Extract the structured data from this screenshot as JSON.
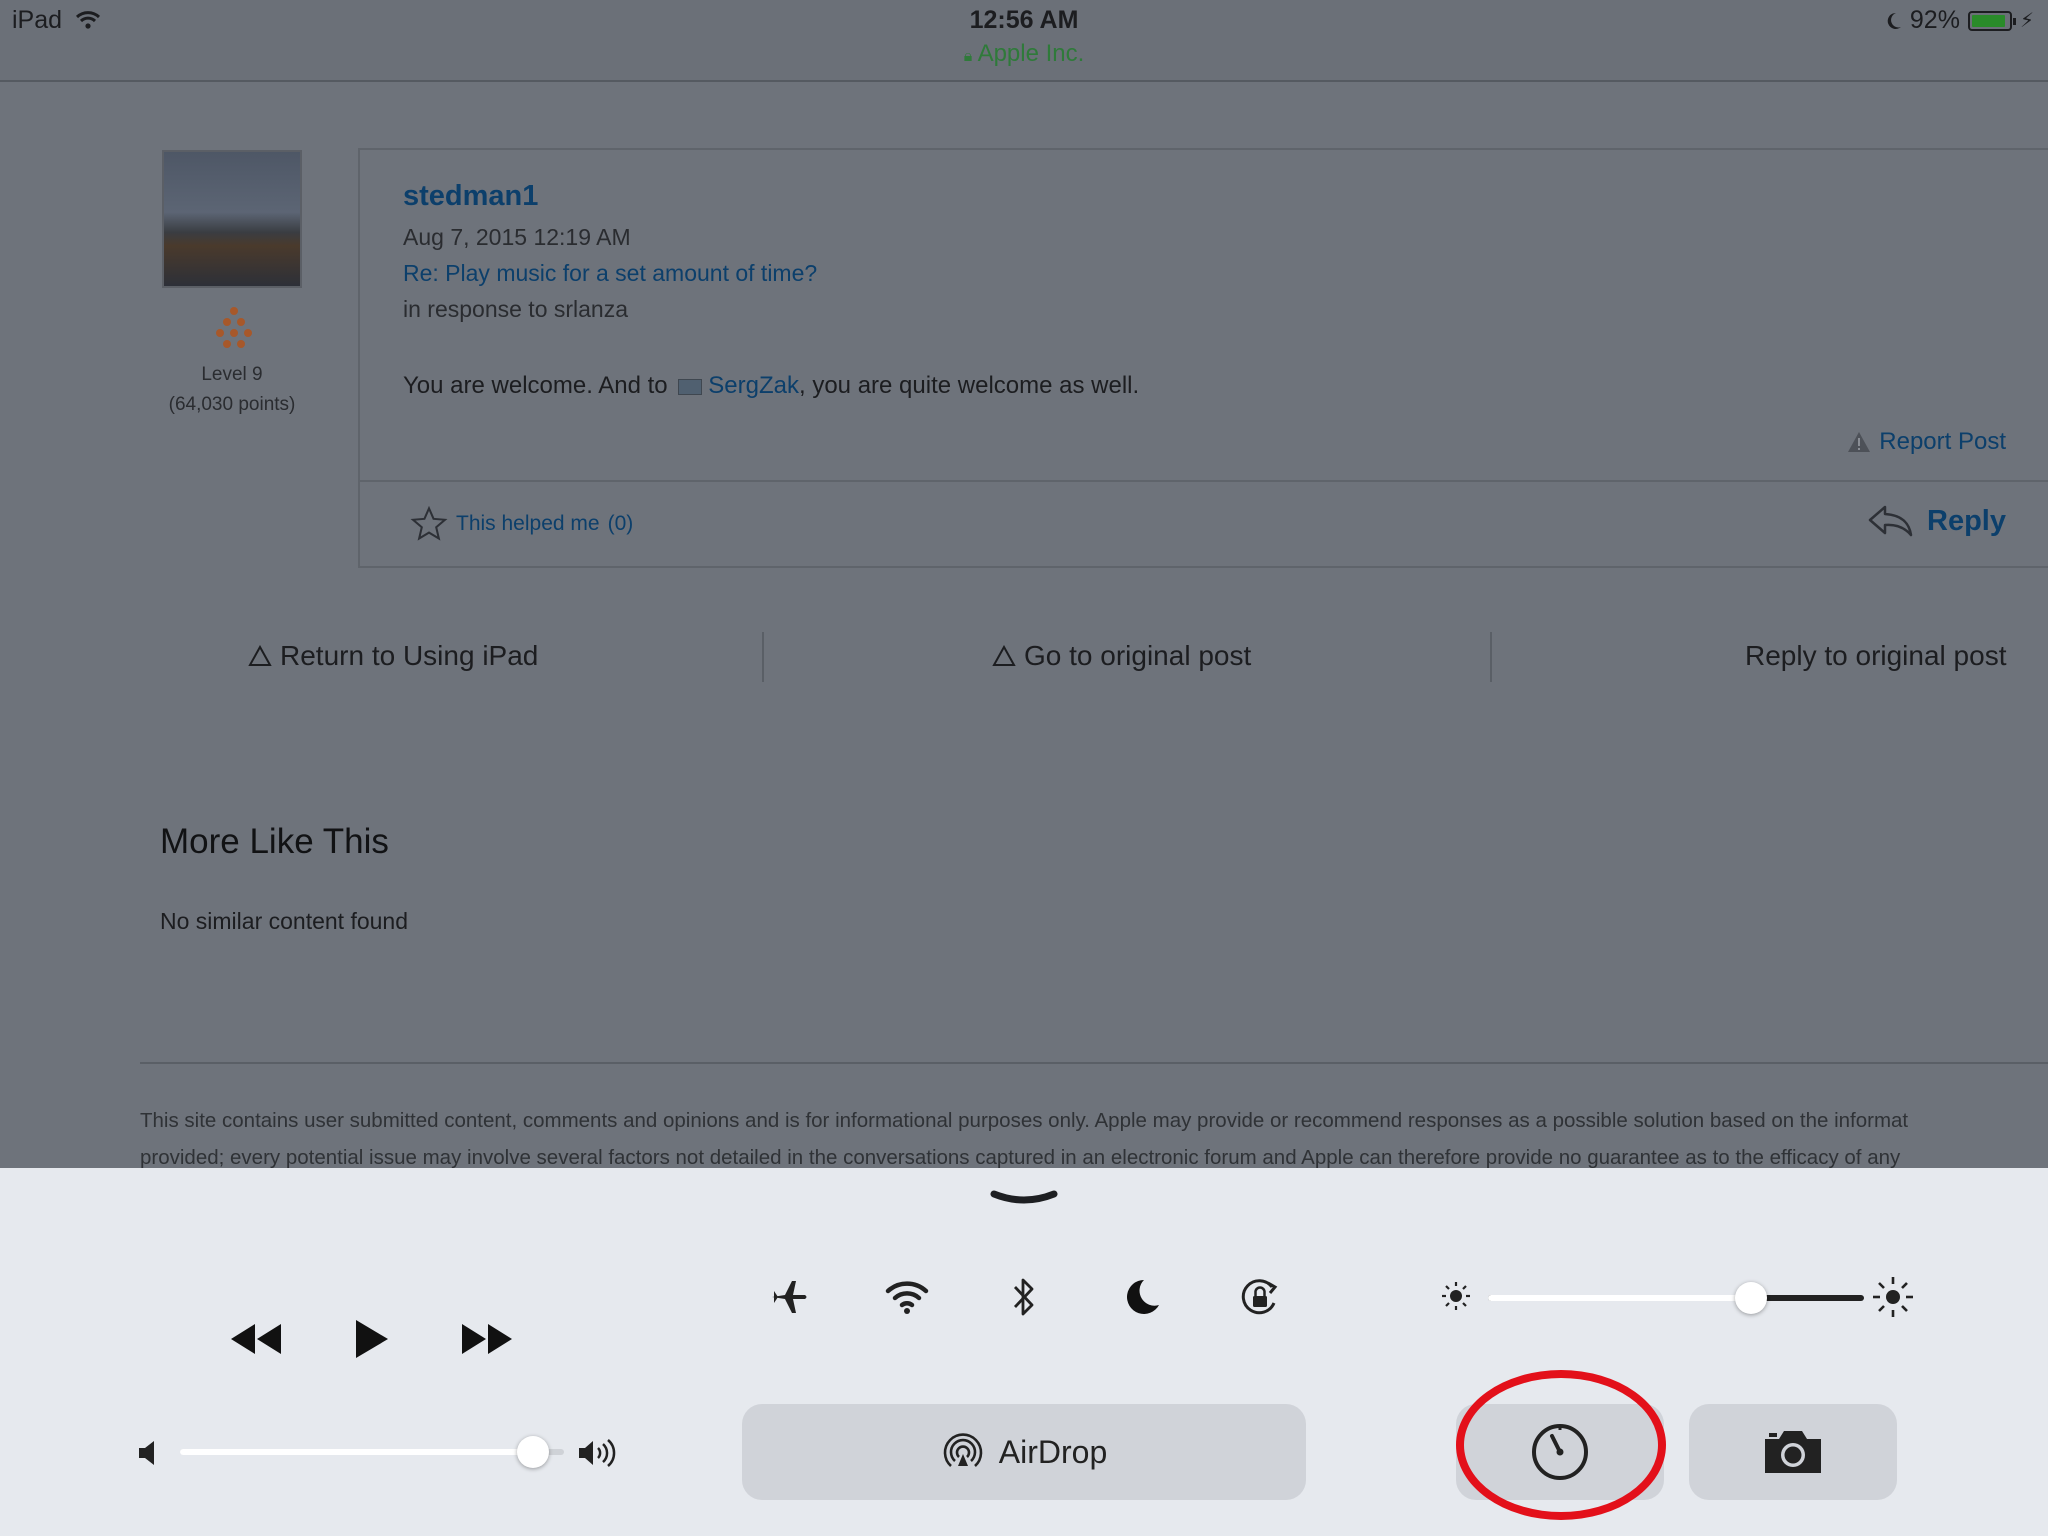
{
  "status_bar": {
    "device": "iPad",
    "time": "12:56 AM",
    "site": "Apple Inc.",
    "battery": "92%",
    "battery_level": 0.92
  },
  "post": {
    "author": "stedman1",
    "date": "Aug 7, 2015 12:19 AM",
    "subject": "Re: Play music for a set amount of time?",
    "in_response": "in response to srlanza",
    "level": "Level 9",
    "points": "(64,030 points)",
    "body_before": "You are welcome. And to ",
    "mention": "SergZak",
    "body_after": ", you are quite welcome as well.",
    "report": "Report Post",
    "helped_label": "This helped me",
    "helped_count": "(0)",
    "reply": "Reply"
  },
  "nav": {
    "return": "Return to Using iPad",
    "original": "Go to original post",
    "reply_original": "Reply to original post"
  },
  "more": {
    "title": "More Like This",
    "empty": "No similar content found"
  },
  "disclaimer": {
    "line1": "This site contains user submitted content, comments and opinions and is for informational purposes only. Apple may provide or recommend responses as a possible solution based on the informat",
    "line2": "provided; every potential issue may involve several factors not detailed in the conversations captured in an electronic forum and Apple can therefore provide no guarantee as to the efficacy of any"
  },
  "control_center": {
    "airdrop": "AirDrop",
    "volume_level": 0.92,
    "brightness_level": 0.7,
    "toggles": [
      {
        "name": "airplane-mode",
        "on": false
      },
      {
        "name": "wifi",
        "on": true
      },
      {
        "name": "bluetooth",
        "on": false
      },
      {
        "name": "do-not-disturb",
        "on": true
      },
      {
        "name": "rotation-lock",
        "on": false
      }
    ]
  }
}
